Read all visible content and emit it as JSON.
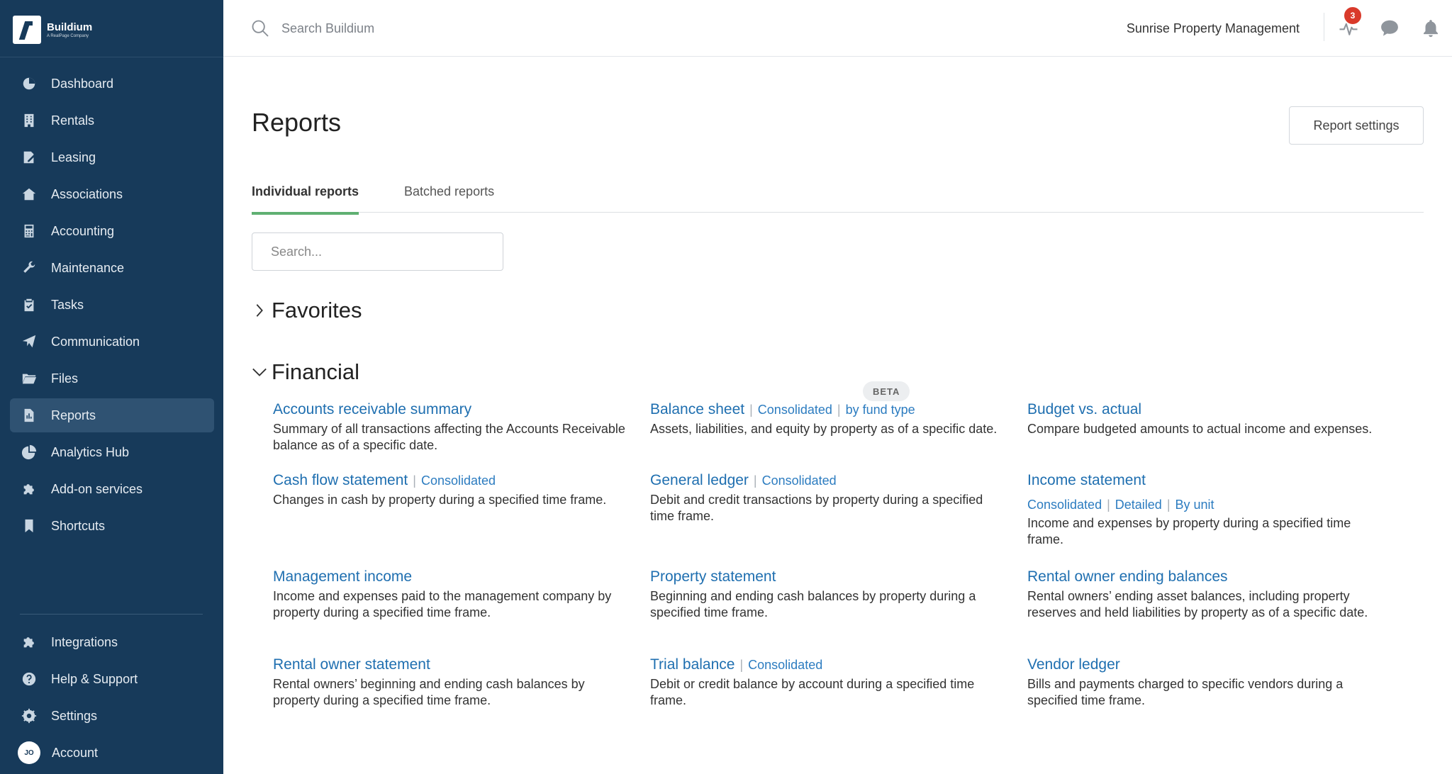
{
  "brand": {
    "name": "Buildium",
    "tagline": "A RealPage Company"
  },
  "sidebar": {
    "items": [
      {
        "label": "Dashboard",
        "icon": "dashboard-icon"
      },
      {
        "label": "Rentals",
        "icon": "building-icon"
      },
      {
        "label": "Leasing",
        "icon": "lease-icon"
      },
      {
        "label": "Associations",
        "icon": "house-icon"
      },
      {
        "label": "Accounting",
        "icon": "calculator-icon"
      },
      {
        "label": "Maintenance",
        "icon": "wrench-icon"
      },
      {
        "label": "Tasks",
        "icon": "clipboard-icon"
      },
      {
        "label": "Communication",
        "icon": "paper-plane-icon"
      },
      {
        "label": "Files",
        "icon": "folder-icon"
      },
      {
        "label": "Reports",
        "icon": "report-icon",
        "active": true
      },
      {
        "label": "Analytics Hub",
        "icon": "pie-chart-icon"
      },
      {
        "label": "Add-on services",
        "icon": "puzzle-icon"
      },
      {
        "label": "Shortcuts",
        "icon": "bookmark-icon"
      }
    ],
    "bottom_items": [
      {
        "label": "Integrations",
        "icon": "puzzle-icon"
      },
      {
        "label": "Help & Support",
        "icon": "help-icon"
      },
      {
        "label": "Settings",
        "icon": "gear-icon"
      }
    ],
    "account": {
      "label": "Account",
      "initials": "JO"
    }
  },
  "header": {
    "search_placeholder": "Search Buildium",
    "company": "Sunrise Property Management",
    "activity_badge": "3"
  },
  "main": {
    "title": "Reports",
    "settings_button": "Report settings",
    "tabs": [
      {
        "label": "Individual reports",
        "active": true
      },
      {
        "label": "Batched reports",
        "active": false
      }
    ],
    "search_placeholder": "Search...",
    "sections": {
      "favorites": "Favorites",
      "financial": "Financial"
    },
    "beta_label": "BETA",
    "reports": [
      {
        "name": "Accounts receivable summary",
        "variants": [],
        "desc": "Summary of all transactions affecting the Accounts Receivable balance as of a specific date."
      },
      {
        "name": "Balance sheet",
        "variants": [
          "Consolidated",
          "by fund type"
        ],
        "desc": "Assets, liabilities, and equity by property as of a specific date."
      },
      {
        "name": "Budget vs. actual",
        "variants": [],
        "desc": "Compare budgeted amounts to actual income and expenses."
      },
      {
        "name": "Cash flow statement",
        "variants": [
          "Consolidated"
        ],
        "desc": "Changes in cash by property during a specified time frame."
      },
      {
        "name": "General ledger",
        "variants": [
          "Consolidated"
        ],
        "desc": "Debit and credit transactions by property during a specified time frame."
      },
      {
        "name": "Income statement",
        "variants": [
          "Consolidated",
          "Detailed",
          "By unit"
        ],
        "desc": "Income and expenses by property during a specified time frame."
      },
      {
        "name": "Management income",
        "variants": [],
        "desc": "Income and expenses paid to the management company by property during a specified time frame."
      },
      {
        "name": "Property statement",
        "variants": [],
        "desc": "Beginning and ending cash balances by property during a specified time frame."
      },
      {
        "name": "Rental owner ending balances",
        "variants": [],
        "desc": "Rental owners’ ending asset balances, including property reserves and held liabilities by property as of a specific date."
      },
      {
        "name": "Rental owner statement",
        "variants": [],
        "desc": "Rental owners’ beginning and ending cash balances by property during a specified time frame."
      },
      {
        "name": "Trial balance",
        "variants": [
          "Consolidated"
        ],
        "desc": "Debit or credit balance by account during a specified time frame."
      },
      {
        "name": "Vendor ledger",
        "variants": [],
        "desc": "Bills and payments charged to specific vendors during a specified time frame."
      }
    ]
  }
}
